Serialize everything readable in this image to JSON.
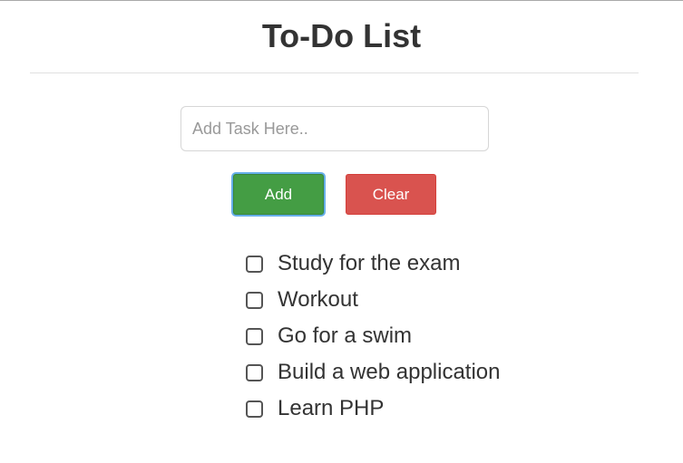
{
  "page": {
    "title": "To-Do List"
  },
  "form": {
    "input_placeholder": "Add Task Here..",
    "input_value": "",
    "add_label": "Add",
    "clear_label": "Clear"
  },
  "tasks": [
    {
      "label": "Study for the exam",
      "checked": false
    },
    {
      "label": "Workout",
      "checked": false
    },
    {
      "label": "Go for a swim",
      "checked": false
    },
    {
      "label": "Build a web application",
      "checked": false
    },
    {
      "label": "Learn PHP",
      "checked": false
    }
  ],
  "colors": {
    "add_button": "#449d44",
    "clear_button": "#d9534f",
    "focus_ring": "#66afe9",
    "text": "#333333"
  }
}
